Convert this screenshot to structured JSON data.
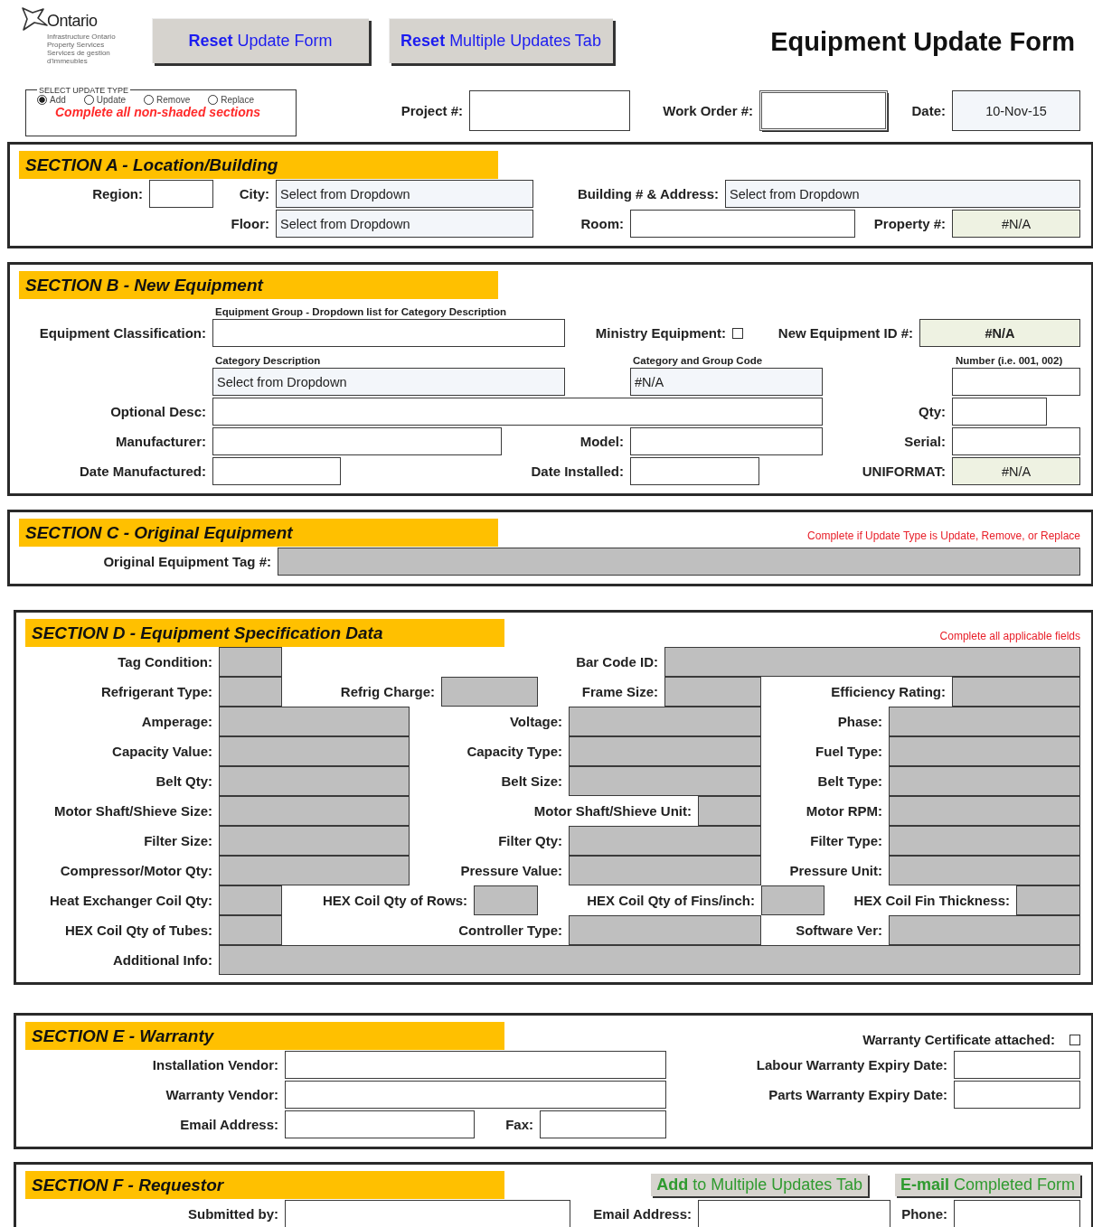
{
  "header": {
    "logo": {
      "name": "Ontario",
      "lines": [
        "Infrastructure Ontario",
        "Property Services",
        "Services de gestion",
        "d'immeubles"
      ]
    },
    "buttons": [
      "**Reset** Update Form",
      "**Reset** Multiple Updates Tab"
    ],
    "title": "Equipment Update Form"
  },
  "update_type": {
    "legend": "SELECT UPDATE TYPE",
    "options": [
      {
        "label": "Add",
        "selected": true
      },
      {
        "label": "Update",
        "selected": false
      },
      {
        "label": "Remove",
        "selected": false
      },
      {
        "label": "Replace",
        "selected": false
      }
    ],
    "note": "Complete all non-shaded sections"
  },
  "top_fields": [
    {
      "kind": "label",
      "text": "Project #:"
    },
    {
      "kind": "input",
      "selected": false
    },
    {
      "kind": "label",
      "text": "Work Order #:"
    },
    {
      "kind": "input",
      "selected": true
    },
    {
      "kind": "label",
      "text": "Date:"
    },
    {
      "kind": "date",
      "value": "10-Nov-15",
      "selected": false
    }
  ],
  "sections": [
    {
      "title": "SECTION A - Location/Building",
      "rows": [
        [
          {
            "kind": "label",
            "text": "Region:"
          },
          {
            "kind": "input"
          },
          {
            "kind": "label",
            "text": "City:"
          },
          {
            "kind": "select",
            "value": "Select from Dropdown"
          },
          {
            "kind": "label",
            "text": "Building # & Address:"
          },
          {
            "kind": "select",
            "value": "Select from Dropdown"
          }
        ],
        [
          {
            "kind": "blank"
          },
          {
            "kind": "blank"
          },
          {
            "kind": "label",
            "text": "Floor:"
          },
          {
            "kind": "select",
            "value": "Select from Dropdown"
          },
          {
            "kind": "label",
            "text": "Room:"
          },
          {
            "kind": "input"
          },
          {
            "kind": "label",
            "text": "Property #:"
          },
          {
            "kind": "formula",
            "value": "#N/A"
          }
        ]
      ]
    },
    {
      "title": "SECTION B - New Equipment",
      "rows": [
        [
          {
            "kind": "blank"
          },
          {
            "kind": "caption",
            "text": "Equipment Group - Dropdown list for Category Description"
          }
        ],
        [
          {
            "kind": "label",
            "text": "Equipment Classification:"
          },
          {
            "kind": "input"
          },
          {
            "kind": "label",
            "text": "Ministry Equipment:"
          },
          {
            "kind": "checkbox",
            "checked": false
          },
          {
            "kind": "label",
            "text": "New Equipment ID #:"
          },
          {
            "kind": "formula",
            "value": "#N/A",
            "bold": true
          }
        ],
        [
          {
            "kind": "blank"
          },
          {
            "kind": "caption",
            "text": "Category Description"
          },
          {
            "kind": "blank"
          },
          {
            "kind": "caption",
            "text": "Category and Group Code"
          },
          {
            "kind": "blank"
          },
          {
            "kind": "caption",
            "text": "Number (i.e. 001, 002)"
          }
        ],
        [
          {
            "kind": "blank"
          },
          {
            "kind": "select",
            "value": "Select from Dropdown"
          },
          {
            "kind": "blank"
          },
          {
            "kind": "select",
            "value": "#N/A"
          },
          {
            "kind": "blank"
          },
          {
            "kind": "input"
          }
        ],
        [
          {
            "kind": "label",
            "text": "Optional Desc:"
          },
          {
            "kind": "input"
          },
          {
            "kind": "blank"
          },
          {
            "kind": "blank"
          },
          {
            "kind": "label",
            "text": "Qty:"
          },
          {
            "kind": "input"
          }
        ],
        [
          {
            "kind": "label",
            "text": "Manufacturer:"
          },
          {
            "kind": "input"
          },
          {
            "kind": "label",
            "text": "Model:"
          },
          {
            "kind": "input"
          },
          {
            "kind": "label",
            "text": "Serial:"
          },
          {
            "kind": "input"
          }
        ],
        [
          {
            "kind": "label",
            "text": "Date Manufactured:"
          },
          {
            "kind": "input"
          },
          {
            "kind": "label",
            "text": "Date Installed:"
          },
          {
            "kind": "input"
          },
          {
            "kind": "label",
            "text": "UNIFORMAT:"
          },
          {
            "kind": "formula",
            "value": "#N/A"
          }
        ]
      ]
    },
    {
      "title": "SECTION C - Original Equipment",
      "header_items": [
        {
          "kind": "note",
          "text": "Complete if Update Type is Update, Remove, or Replace"
        }
      ],
      "rows": [
        [
          {
            "kind": "label",
            "text": "Original Equipment Tag #:"
          },
          {
            "kind": "locked"
          }
        ]
      ]
    },
    {
      "title": "SECTION D - Equipment Specification Data",
      "header_items": [
        {
          "kind": "note",
          "text": "Complete all applicable fields"
        }
      ],
      "rows": [
        [
          {
            "kind": "label",
            "text": "Tag Condition:"
          },
          {
            "kind": "locked"
          },
          {
            "kind": "label",
            "text": "Bar Code ID:"
          },
          {
            "kind": "locked"
          }
        ],
        [
          {
            "kind": "label",
            "text": "Refrigerant Type:"
          },
          {
            "kind": "locked"
          },
          {
            "kind": "label",
            "text": "Refrig Charge:"
          },
          {
            "kind": "locked"
          },
          {
            "kind": "label",
            "text": "Frame Size:"
          },
          {
            "kind": "locked"
          },
          {
            "kind": "label",
            "text": "Efficiency Rating:"
          },
          {
            "kind": "locked"
          }
        ],
        [
          {
            "kind": "label",
            "text": "Amperage:"
          },
          {
            "kind": "locked"
          },
          {
            "kind": "label",
            "text": "Voltage:"
          },
          {
            "kind": "locked"
          },
          {
            "kind": "label",
            "text": "Phase:"
          },
          {
            "kind": "locked"
          }
        ],
        [
          {
            "kind": "label",
            "text": "Capacity Value:"
          },
          {
            "kind": "locked"
          },
          {
            "kind": "label",
            "text": "Capacity Type:"
          },
          {
            "kind": "locked"
          },
          {
            "kind": "label",
            "text": "Fuel Type:"
          },
          {
            "kind": "locked"
          }
        ],
        [
          {
            "kind": "label",
            "text": "Belt Qty:"
          },
          {
            "kind": "locked"
          },
          {
            "kind": "label",
            "text": "Belt Size:"
          },
          {
            "kind": "locked"
          },
          {
            "kind": "label",
            "text": "Belt Type:"
          },
          {
            "kind": "locked"
          }
        ],
        [
          {
            "kind": "label",
            "text": "Motor Shaft/Shieve Size:"
          },
          {
            "kind": "locked"
          },
          {
            "kind": "label",
            "text": "Motor Shaft/Shieve Unit:"
          },
          {
            "kind": "locked"
          },
          {
            "kind": "label",
            "text": "Motor RPM:"
          },
          {
            "kind": "locked"
          }
        ],
        [
          {
            "kind": "label",
            "text": "Filter Size:"
          },
          {
            "kind": "locked"
          },
          {
            "kind": "label",
            "text": "Filter Qty:"
          },
          {
            "kind": "locked"
          },
          {
            "kind": "label",
            "text": "Filter Type:"
          },
          {
            "kind": "locked"
          }
        ],
        [
          {
            "kind": "label",
            "text": "Compressor/Motor Qty:"
          },
          {
            "kind": "locked"
          },
          {
            "kind": "label",
            "text": "Pressure Value:"
          },
          {
            "kind": "locked"
          },
          {
            "kind": "label",
            "text": "Pressure Unit:"
          },
          {
            "kind": "locked"
          }
        ],
        [
          {
            "kind": "label",
            "text": "Heat Exchanger Coil Qty:"
          },
          {
            "kind": "locked"
          },
          {
            "kind": "label",
            "text": "HEX Coil Qty of Rows:"
          },
          {
            "kind": "locked"
          },
          {
            "kind": "label",
            "text": "HEX Coil Qty of Fins/inch:"
          },
          {
            "kind": "locked"
          },
          {
            "kind": "label",
            "text": "HEX Coil Fin Thickness:"
          },
          {
            "kind": "locked"
          }
        ],
        [
          {
            "kind": "label",
            "text": "HEX Coil Qty of Tubes:"
          },
          {
            "kind": "locked"
          },
          {
            "kind": "label",
            "text": "Controller Type:"
          },
          {
            "kind": "locked"
          },
          {
            "kind": "label",
            "text": "Software Ver:"
          },
          {
            "kind": "locked"
          }
        ],
        [
          {
            "kind": "label",
            "text": "Additional Info:"
          },
          {
            "kind": "locked"
          }
        ]
      ]
    },
    {
      "title": "SECTION E - Warranty",
      "header_items": [
        {
          "kind": "label",
          "text": "Warranty Certificate attached:"
        },
        {
          "kind": "checkbox",
          "checked": false
        }
      ],
      "rows": [
        [
          {
            "kind": "label",
            "text": "Installation Vendor:"
          },
          {
            "kind": "input"
          },
          {
            "kind": "label",
            "text": "Labour Warranty Expiry Date:"
          },
          {
            "kind": "input"
          }
        ],
        [
          {
            "kind": "label",
            "text": "Warranty Vendor:"
          },
          {
            "kind": "input"
          },
          {
            "kind": "label",
            "text": "Parts Warranty Expiry Date:"
          },
          {
            "kind": "input"
          }
        ],
        [
          {
            "kind": "label",
            "text": "Email Address:"
          },
          {
            "kind": "input"
          },
          {
            "kind": "label",
            "text": "Fax:"
          },
          {
            "kind": "input"
          }
        ]
      ]
    },
    {
      "title": "SECTION F - Requestor",
      "header_items": [
        {
          "kind": "button",
          "text": "**Add** to Multiple Updates Tab"
        },
        {
          "kind": "button",
          "text": "**E-mail** Completed Form"
        }
      ],
      "rows": [
        [
          {
            "kind": "label",
            "text": "Submitted by:"
          },
          {
            "kind": "input"
          },
          {
            "kind": "label",
            "text": "Email Address:"
          },
          {
            "kind": "input"
          },
          {
            "kind": "label",
            "text": "Phone:"
          },
          {
            "kind": "input"
          }
        ]
      ]
    }
  ]
}
